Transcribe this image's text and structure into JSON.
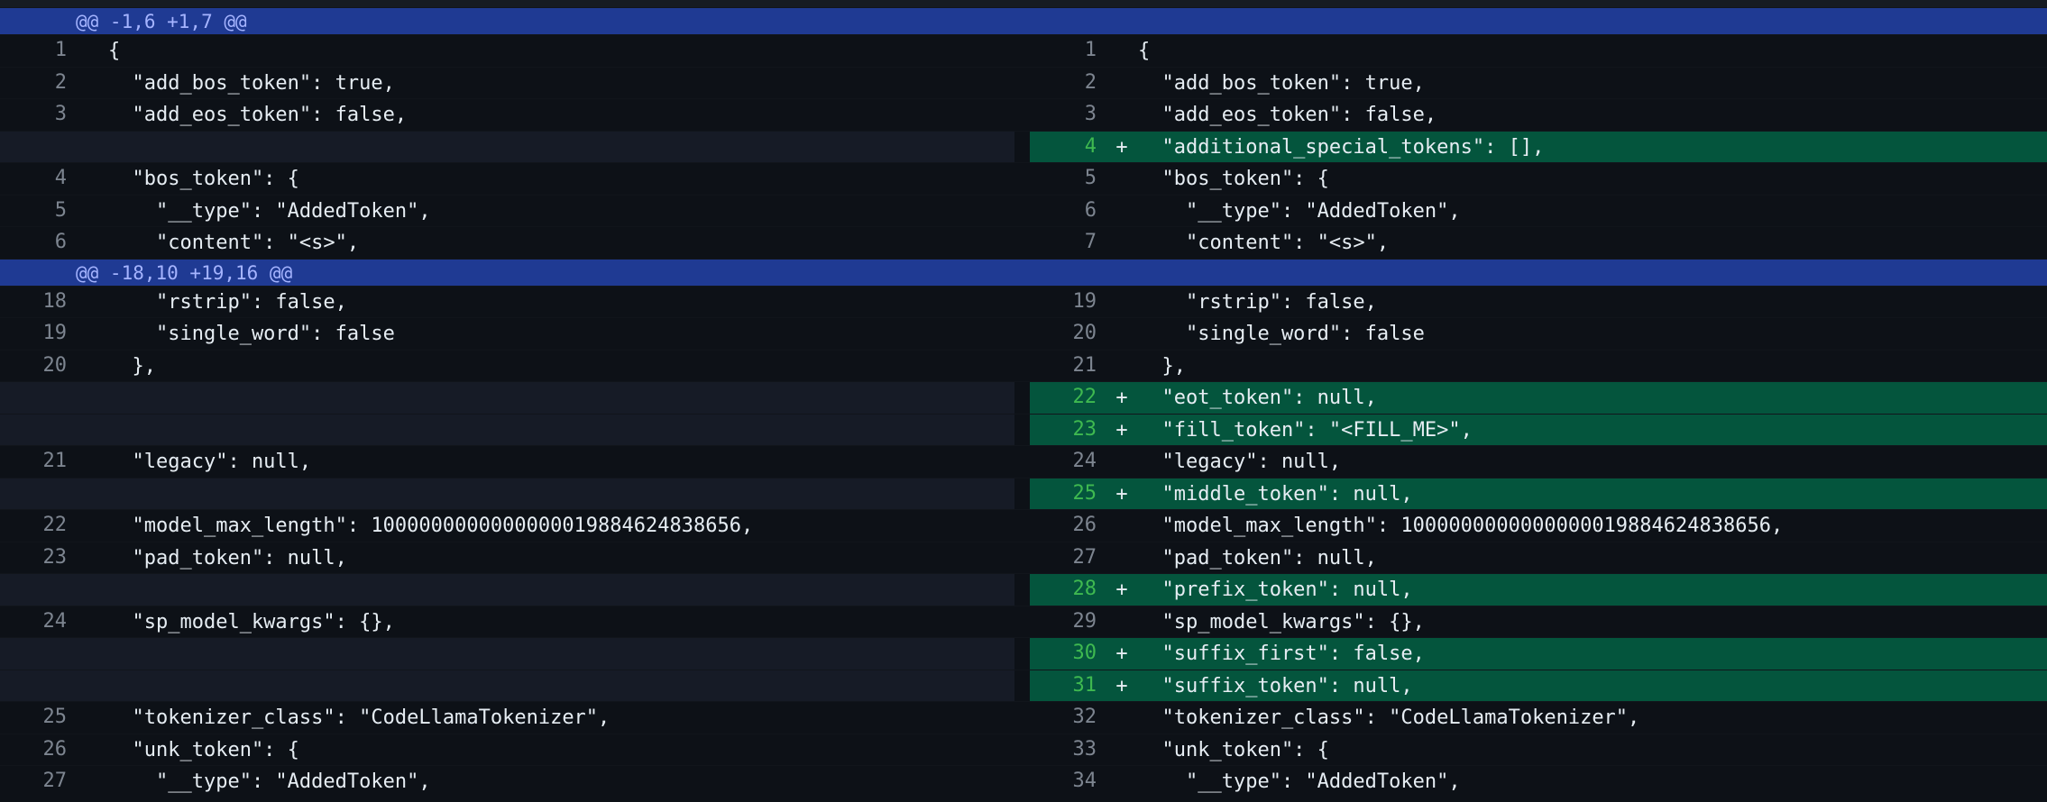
{
  "colors": {
    "background": "#0d1117",
    "hunk_header": "#1f3a93",
    "added_line": "#04553d",
    "empty_filler": "#161b26",
    "line_number": "#7d8590",
    "added_line_number": "#3fb950"
  },
  "rows": [
    {
      "type": "hunk",
      "text": "@@ -1,6 +1,7 @@"
    },
    {
      "type": "context",
      "left_ln": "1",
      "left_code": "{",
      "right_ln": "1",
      "right_code": "{"
    },
    {
      "type": "context",
      "left_ln": "2",
      "left_code": "  \"add_bos_token\": true,",
      "right_ln": "2",
      "right_code": "  \"add_bos_token\": true,"
    },
    {
      "type": "context",
      "left_ln": "3",
      "left_code": "  \"add_eos_token\": false,",
      "right_ln": "3",
      "right_code": "  \"add_eos_token\": false,"
    },
    {
      "type": "added",
      "right_ln": "4",
      "right_code": "  \"additional_special_tokens\": [],",
      "marker": "+"
    },
    {
      "type": "context",
      "left_ln": "4",
      "left_code": "  \"bos_token\": {",
      "right_ln": "5",
      "right_code": "  \"bos_token\": {"
    },
    {
      "type": "context",
      "left_ln": "5",
      "left_code": "    \"__type\": \"AddedToken\",",
      "right_ln": "6",
      "right_code": "    \"__type\": \"AddedToken\","
    },
    {
      "type": "context",
      "left_ln": "6",
      "left_code": "    \"content\": \"<s>\",",
      "right_ln": "7",
      "right_code": "    \"content\": \"<s>\","
    },
    {
      "type": "hunk",
      "text": "@@ -18,10 +19,16 @@"
    },
    {
      "type": "context",
      "left_ln": "18",
      "left_code": "    \"rstrip\": false,",
      "right_ln": "19",
      "right_code": "    \"rstrip\": false,"
    },
    {
      "type": "context",
      "left_ln": "19",
      "left_code": "    \"single_word\": false",
      "right_ln": "20",
      "right_code": "    \"single_word\": false"
    },
    {
      "type": "context",
      "left_ln": "20",
      "left_code": "  },",
      "right_ln": "21",
      "right_code": "  },"
    },
    {
      "type": "added",
      "right_ln": "22",
      "right_code": "  \"eot_token\": null,",
      "marker": "+"
    },
    {
      "type": "added",
      "right_ln": "23",
      "right_code": "  \"fill_token\": \"<FILL_ME>\",",
      "marker": "+"
    },
    {
      "type": "context",
      "left_ln": "21",
      "left_code": "  \"legacy\": null,",
      "right_ln": "24",
      "right_code": "  \"legacy\": null,"
    },
    {
      "type": "added",
      "right_ln": "25",
      "right_code": "  \"middle_token\": null,",
      "marker": "+"
    },
    {
      "type": "context",
      "left_ln": "22",
      "left_code": "  \"model_max_length\": 1000000000000000019884624838656,",
      "right_ln": "26",
      "right_code": "  \"model_max_length\": 1000000000000000019884624838656,"
    },
    {
      "type": "context",
      "left_ln": "23",
      "left_code": "  \"pad_token\": null,",
      "right_ln": "27",
      "right_code": "  \"pad_token\": null,"
    },
    {
      "type": "added",
      "right_ln": "28",
      "right_code": "  \"prefix_token\": null,",
      "marker": "+"
    },
    {
      "type": "context",
      "left_ln": "24",
      "left_code": "  \"sp_model_kwargs\": {},",
      "right_ln": "29",
      "right_code": "  \"sp_model_kwargs\": {},"
    },
    {
      "type": "added",
      "right_ln": "30",
      "right_code": "  \"suffix_first\": false,",
      "marker": "+"
    },
    {
      "type": "added",
      "right_ln": "31",
      "right_code": "  \"suffix_token\": null,",
      "marker": "+"
    },
    {
      "type": "context",
      "left_ln": "25",
      "left_code": "  \"tokenizer_class\": \"CodeLlamaTokenizer\",",
      "right_ln": "32",
      "right_code": "  \"tokenizer_class\": \"CodeLlamaTokenizer\","
    },
    {
      "type": "context",
      "left_ln": "26",
      "left_code": "  \"unk_token\": {",
      "right_ln": "33",
      "right_code": "  \"unk_token\": {"
    },
    {
      "type": "context",
      "left_ln": "27",
      "left_code": "    \"__type\": \"AddedToken\",",
      "right_ln": "34",
      "right_code": "    \"__type\": \"AddedToken\","
    }
  ]
}
